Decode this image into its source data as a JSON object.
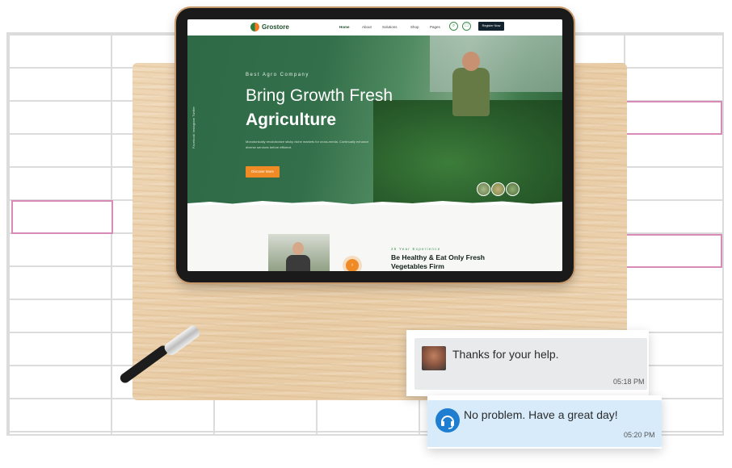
{
  "site": {
    "logo_text": "Grostore",
    "nav_items": [
      "Home",
      "About",
      "Solutions",
      "Shop",
      "Pages"
    ],
    "register_label": "Register Now",
    "social_links": "Facebook   Instagram   Twitter"
  },
  "hero": {
    "eyebrow": "Best Agro Company",
    "title_line1": "Bring Growth Fresh",
    "title_line2": "Agriculture",
    "description": "Monotonically revolutionize sticky niche markets for cross-media. Continually enhance diverse services before efficient.",
    "button_label": "Discover More"
  },
  "about": {
    "experience_label": "25 Year Experience",
    "title": "Be Healthy & Eat Only Fresh Vegetables Firm"
  },
  "chat": {
    "incoming": {
      "text": "Thanks for your help.",
      "time": "05:18 PM"
    },
    "outgoing": {
      "text": "No problem. Have a great day!",
      "time": "05:20 PM"
    }
  },
  "colors": {
    "brand_green": "#2d6a45",
    "accent_orange": "#f08a24",
    "bubble_blue": "#d7ebfb",
    "bubble_gray": "#e9eaec"
  }
}
